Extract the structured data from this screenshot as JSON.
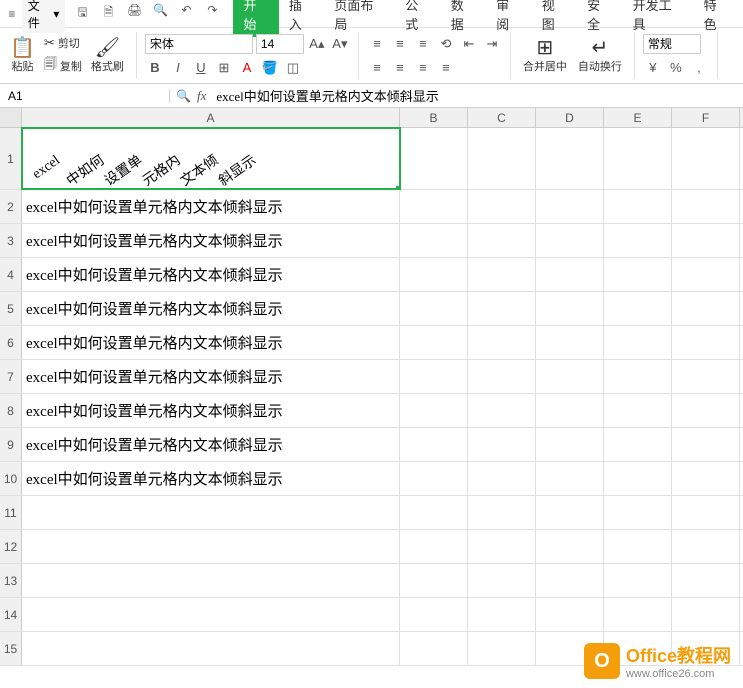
{
  "menubar": {
    "file_label": "文件",
    "tabs": [
      "开始",
      "插入",
      "页面布局",
      "公式",
      "数据",
      "审阅",
      "视图",
      "安全",
      "开发工具",
      "特色"
    ],
    "active_tab_index": 0
  },
  "ribbon": {
    "paste_label": "粘贴",
    "cut_label": "剪切",
    "copy_label": "复制",
    "format_painter_label": "格式刷",
    "font_name": "宋体",
    "font_size": "14",
    "merge_label": "合并居中",
    "wrap_label": "自动换行",
    "style_label": "常规"
  },
  "formula_bar": {
    "cell_ref": "A1",
    "fx_label": "fx",
    "formula": "excel中如何设置单元格内文本倾斜显示"
  },
  "columns": [
    "A",
    "B",
    "C",
    "D",
    "E",
    "F"
  ],
  "row_numbers": [
    "1",
    "2",
    "3",
    "4",
    "5",
    "6",
    "7",
    "8",
    "9",
    "10",
    "11",
    "12",
    "13",
    "14",
    "15"
  ],
  "a1_rotated_words": [
    "excel",
    "中如何",
    "设置单",
    "元格内",
    "文本倾",
    "斜显示"
  ],
  "cell_text": "excel中如何设置单元格内文本倾斜显示",
  "data_rows": [
    2,
    3,
    4,
    5,
    6,
    7,
    8,
    9,
    10
  ],
  "watermark": {
    "title": "Office教程网",
    "url": "www.office26.com"
  }
}
